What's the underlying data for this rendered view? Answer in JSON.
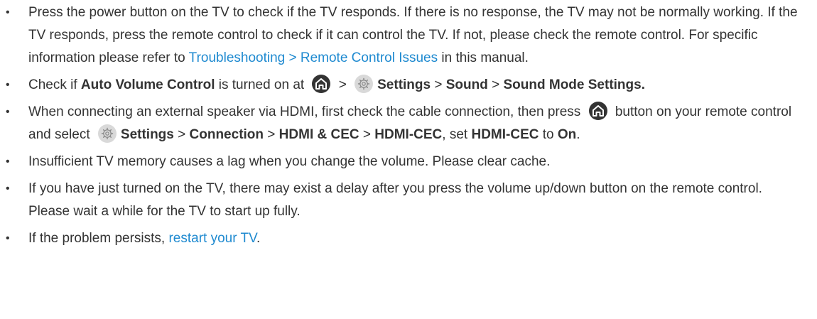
{
  "items": [
    {
      "t1": "Press the power button on the TV to check if the TV responds. If there is no response, the TV may not be normally working. If the TV responds, press the remote control to check if it can control the TV. If not, please check the remote control. For specific information please refer to ",
      "link": "Troubleshooting > Remote Control Issues",
      "t2": " in this manual."
    },
    {
      "t1": "Check if ",
      "b1": "Auto Volume Control",
      "t2": " is turned on at ",
      "sep1": " > ",
      "b2": "Settings",
      "sep2": " > ",
      "b3": "Sound",
      "sep3": " > ",
      "b4": "Sound Mode Settings."
    },
    {
      "t1": "When connecting an external speaker via HDMI, first check the cable connection, then press ",
      "t2": " button on your remote control and select ",
      "b1": "Settings",
      "sep1": " > ",
      "b2": "Connection",
      "sep2": " > ",
      "b3": "HDMI & CEC",
      "sep3": " > ",
      "b4": "HDMI-CEC",
      "t3": ", set ",
      "b5": "HDMI-CEC",
      "t4": " to ",
      "b6": "On",
      "t5": "."
    },
    {
      "t1": "Insufficient TV memory causes a lag when you change the volume. Please clear cache."
    },
    {
      "t1": "If you have just turned on the TV, there may exist a delay after you press the volume up/down button on the remote control. Please wait a while for the TV to start up fully."
    },
    {
      "t1": "If the problem persists, ",
      "link": "restart your TV",
      "t2": "."
    }
  ],
  "icons": {
    "home": "home-icon",
    "settings": "settings-gear-icon"
  },
  "colors": {
    "text": "#333333",
    "link": "#1f8ad0",
    "home_icon_bg": "#333333",
    "settings_icon_bg": "#d9d9d9"
  }
}
